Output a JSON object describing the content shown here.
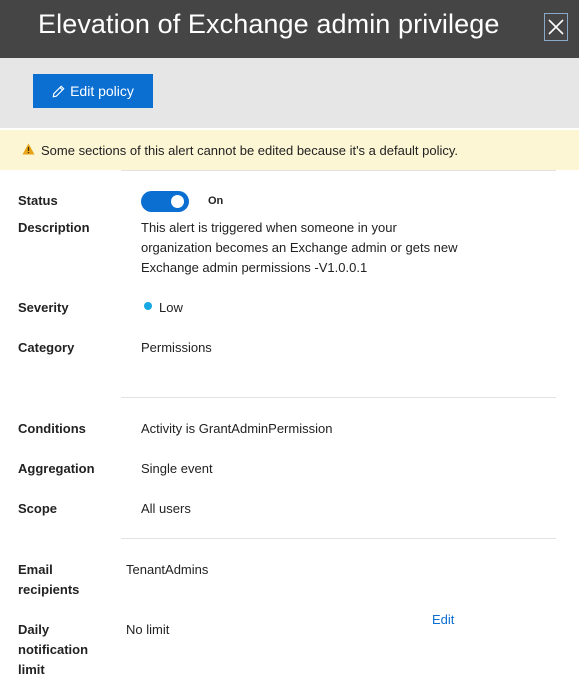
{
  "panel": {
    "title": "Elevation of Exchange admin privilege",
    "close_icon": "close-icon"
  },
  "toolbar": {
    "edit_policy_label": "Edit policy",
    "edit_icon": "pencil-icon"
  },
  "banner": {
    "icon": "warning-icon",
    "icon_color": "#e8a317",
    "text": "Some sections of this alert cannot be edited because it's a default policy.",
    "background": "#fcf6d4"
  },
  "details": {
    "status": {
      "label": "Status",
      "toggle_state": "On",
      "on": true
    },
    "description": {
      "label": "Description",
      "lines": [
        "This alert is triggered when someone in your",
        "organization becomes an Exchange admin or gets new",
        "Exchange admin permissions -V1.0.0.1"
      ]
    },
    "severity": {
      "label": "Severity",
      "value": "Low",
      "dot_color": "#17a8e3"
    },
    "category": {
      "label": "Category",
      "value": "Permissions"
    }
  },
  "conditions": {
    "conditions": {
      "label": "Conditions",
      "value": "Activity is GrantAdminPermission"
    },
    "aggregation": {
      "label": "Aggregation",
      "value": "Single event"
    },
    "scope": {
      "label": "Scope",
      "value": "All users"
    }
  },
  "notifications": {
    "email_recipients": {
      "label_line1": "Email",
      "label_line2": "recipients",
      "value": "TenantAdmins"
    },
    "daily_limit": {
      "label_line1": "Daily",
      "label_line2": "notification",
      "label_line3": "limit",
      "value": "No limit"
    },
    "edit_link": "Edit"
  },
  "colors": {
    "accent": "#0a6fd1",
    "header_bg": "#454545",
    "toolbar_bg": "#e6e6e6"
  }
}
